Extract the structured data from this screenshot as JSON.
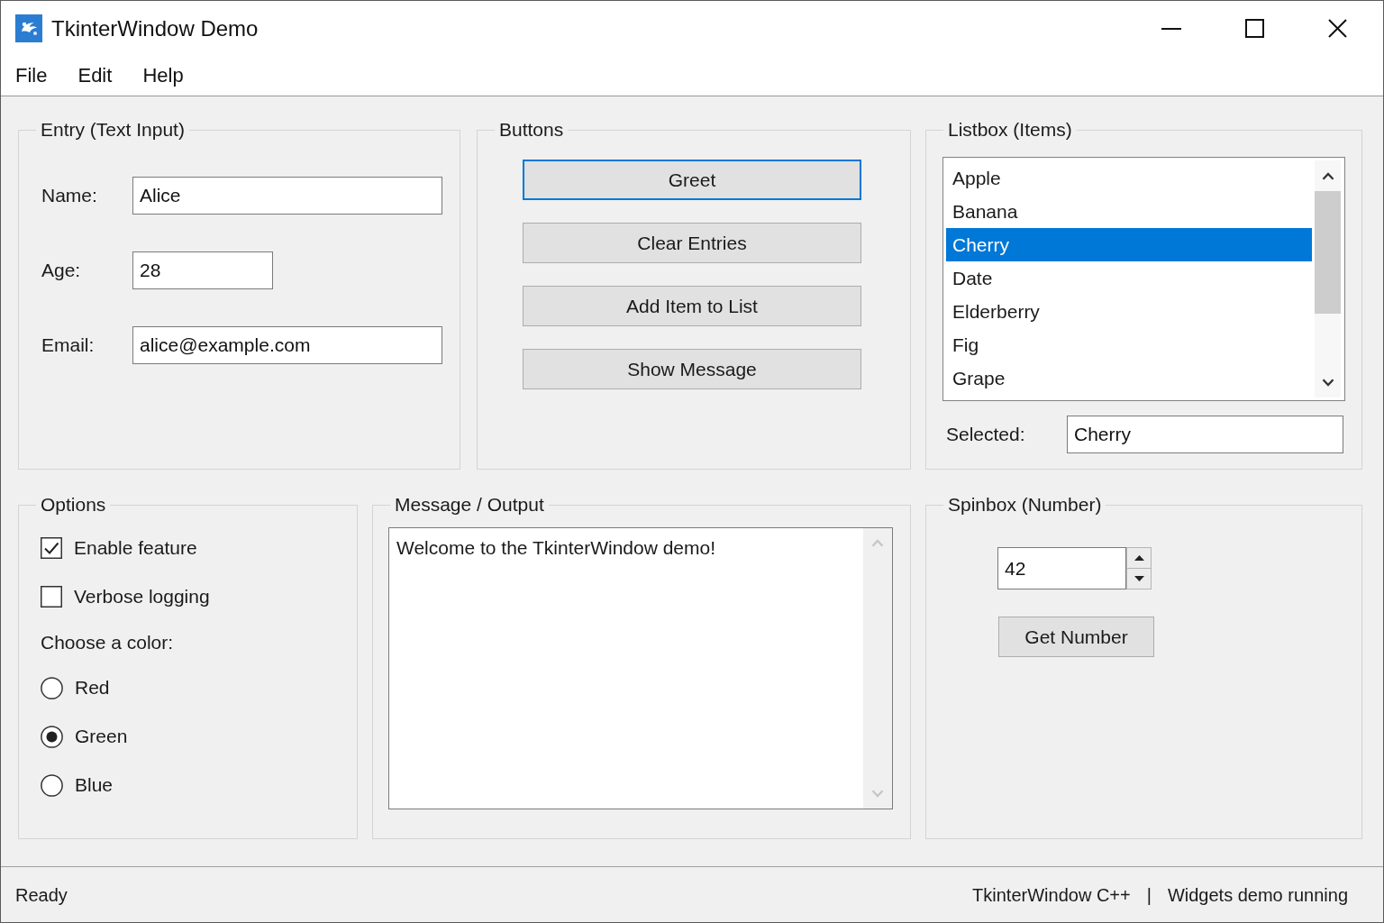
{
  "window": {
    "title": "TkinterWindow Demo"
  },
  "menu": [
    "File",
    "Edit",
    "Help"
  ],
  "entry_group": {
    "title": "Entry (Text Input)",
    "fields": [
      {
        "label": "Name:",
        "value": "Alice",
        "kind": "text"
      },
      {
        "label": "Age:",
        "value": "28",
        "kind": "number"
      },
      {
        "label": "Email:",
        "value": "alice@example.com",
        "kind": "text"
      }
    ]
  },
  "buttons_group": {
    "title": "Buttons",
    "buttons": [
      {
        "label": "Greet",
        "focused": true
      },
      {
        "label": "Clear Entries",
        "focused": false
      },
      {
        "label": "Add Item to List",
        "focused": false
      },
      {
        "label": "Show Message",
        "focused": false
      }
    ]
  },
  "listbox_group": {
    "title": "Listbox (Items)",
    "items": [
      {
        "label": "Apple",
        "selected": false
      },
      {
        "label": "Banana",
        "selected": false
      },
      {
        "label": "Cherry",
        "selected": true
      },
      {
        "label": "Date",
        "selected": false
      },
      {
        "label": "Elderberry",
        "selected": false
      },
      {
        "label": "Fig",
        "selected": false
      },
      {
        "label": "Grape",
        "selected": false
      }
    ],
    "selected_label": "Selected:",
    "selected_value": "Cherry"
  },
  "options_group": {
    "title": "Options",
    "checkboxes": [
      {
        "label": "Enable feature",
        "checked": true
      },
      {
        "label": "Verbose logging",
        "checked": false
      }
    ],
    "radio_label": "Choose a color:",
    "radios": [
      {
        "label": "Red",
        "selected": false
      },
      {
        "label": "Green",
        "selected": true
      },
      {
        "label": "Blue",
        "selected": false
      }
    ]
  },
  "message_group": {
    "title": "Message / Output",
    "text": "Welcome to the TkinterWindow demo!"
  },
  "spinbox_group": {
    "title": "Spinbox (Number)",
    "value": "42",
    "button": "Get Number"
  },
  "status_bar": {
    "left": "Ready",
    "app": "TkinterWindow C++",
    "separator": "|",
    "message": "Widgets demo running"
  }
}
